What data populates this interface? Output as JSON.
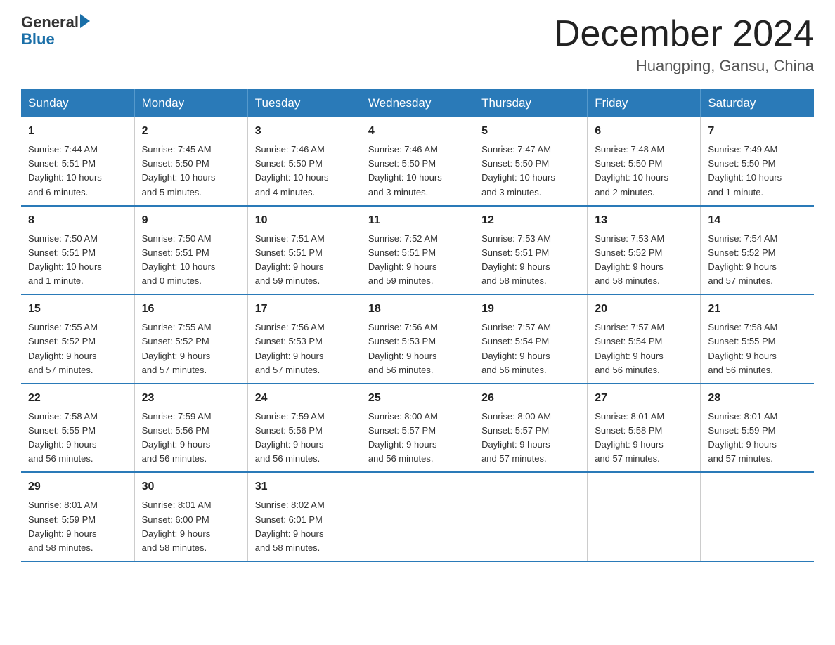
{
  "header": {
    "logo_general": "General",
    "logo_blue": "Blue",
    "month_title": "December 2024",
    "location": "Huangping, Gansu, China"
  },
  "weekdays": [
    "Sunday",
    "Monday",
    "Tuesday",
    "Wednesday",
    "Thursday",
    "Friday",
    "Saturday"
  ],
  "weeks": [
    [
      {
        "day": "1",
        "info": "Sunrise: 7:44 AM\nSunset: 5:51 PM\nDaylight: 10 hours\nand 6 minutes."
      },
      {
        "day": "2",
        "info": "Sunrise: 7:45 AM\nSunset: 5:50 PM\nDaylight: 10 hours\nand 5 minutes."
      },
      {
        "day": "3",
        "info": "Sunrise: 7:46 AM\nSunset: 5:50 PM\nDaylight: 10 hours\nand 4 minutes."
      },
      {
        "day": "4",
        "info": "Sunrise: 7:46 AM\nSunset: 5:50 PM\nDaylight: 10 hours\nand 3 minutes."
      },
      {
        "day": "5",
        "info": "Sunrise: 7:47 AM\nSunset: 5:50 PM\nDaylight: 10 hours\nand 3 minutes."
      },
      {
        "day": "6",
        "info": "Sunrise: 7:48 AM\nSunset: 5:50 PM\nDaylight: 10 hours\nand 2 minutes."
      },
      {
        "day": "7",
        "info": "Sunrise: 7:49 AM\nSunset: 5:50 PM\nDaylight: 10 hours\nand 1 minute."
      }
    ],
    [
      {
        "day": "8",
        "info": "Sunrise: 7:50 AM\nSunset: 5:51 PM\nDaylight: 10 hours\nand 1 minute."
      },
      {
        "day": "9",
        "info": "Sunrise: 7:50 AM\nSunset: 5:51 PM\nDaylight: 10 hours\nand 0 minutes."
      },
      {
        "day": "10",
        "info": "Sunrise: 7:51 AM\nSunset: 5:51 PM\nDaylight: 9 hours\nand 59 minutes."
      },
      {
        "day": "11",
        "info": "Sunrise: 7:52 AM\nSunset: 5:51 PM\nDaylight: 9 hours\nand 59 minutes."
      },
      {
        "day": "12",
        "info": "Sunrise: 7:53 AM\nSunset: 5:51 PM\nDaylight: 9 hours\nand 58 minutes."
      },
      {
        "day": "13",
        "info": "Sunrise: 7:53 AM\nSunset: 5:52 PM\nDaylight: 9 hours\nand 58 minutes."
      },
      {
        "day": "14",
        "info": "Sunrise: 7:54 AM\nSunset: 5:52 PM\nDaylight: 9 hours\nand 57 minutes."
      }
    ],
    [
      {
        "day": "15",
        "info": "Sunrise: 7:55 AM\nSunset: 5:52 PM\nDaylight: 9 hours\nand 57 minutes."
      },
      {
        "day": "16",
        "info": "Sunrise: 7:55 AM\nSunset: 5:52 PM\nDaylight: 9 hours\nand 57 minutes."
      },
      {
        "day": "17",
        "info": "Sunrise: 7:56 AM\nSunset: 5:53 PM\nDaylight: 9 hours\nand 57 minutes."
      },
      {
        "day": "18",
        "info": "Sunrise: 7:56 AM\nSunset: 5:53 PM\nDaylight: 9 hours\nand 56 minutes."
      },
      {
        "day": "19",
        "info": "Sunrise: 7:57 AM\nSunset: 5:54 PM\nDaylight: 9 hours\nand 56 minutes."
      },
      {
        "day": "20",
        "info": "Sunrise: 7:57 AM\nSunset: 5:54 PM\nDaylight: 9 hours\nand 56 minutes."
      },
      {
        "day": "21",
        "info": "Sunrise: 7:58 AM\nSunset: 5:55 PM\nDaylight: 9 hours\nand 56 minutes."
      }
    ],
    [
      {
        "day": "22",
        "info": "Sunrise: 7:58 AM\nSunset: 5:55 PM\nDaylight: 9 hours\nand 56 minutes."
      },
      {
        "day": "23",
        "info": "Sunrise: 7:59 AM\nSunset: 5:56 PM\nDaylight: 9 hours\nand 56 minutes."
      },
      {
        "day": "24",
        "info": "Sunrise: 7:59 AM\nSunset: 5:56 PM\nDaylight: 9 hours\nand 56 minutes."
      },
      {
        "day": "25",
        "info": "Sunrise: 8:00 AM\nSunset: 5:57 PM\nDaylight: 9 hours\nand 56 minutes."
      },
      {
        "day": "26",
        "info": "Sunrise: 8:00 AM\nSunset: 5:57 PM\nDaylight: 9 hours\nand 57 minutes."
      },
      {
        "day": "27",
        "info": "Sunrise: 8:01 AM\nSunset: 5:58 PM\nDaylight: 9 hours\nand 57 minutes."
      },
      {
        "day": "28",
        "info": "Sunrise: 8:01 AM\nSunset: 5:59 PM\nDaylight: 9 hours\nand 57 minutes."
      }
    ],
    [
      {
        "day": "29",
        "info": "Sunrise: 8:01 AM\nSunset: 5:59 PM\nDaylight: 9 hours\nand 58 minutes."
      },
      {
        "day": "30",
        "info": "Sunrise: 8:01 AM\nSunset: 6:00 PM\nDaylight: 9 hours\nand 58 minutes."
      },
      {
        "day": "31",
        "info": "Sunrise: 8:02 AM\nSunset: 6:01 PM\nDaylight: 9 hours\nand 58 minutes."
      },
      null,
      null,
      null,
      null
    ]
  ]
}
